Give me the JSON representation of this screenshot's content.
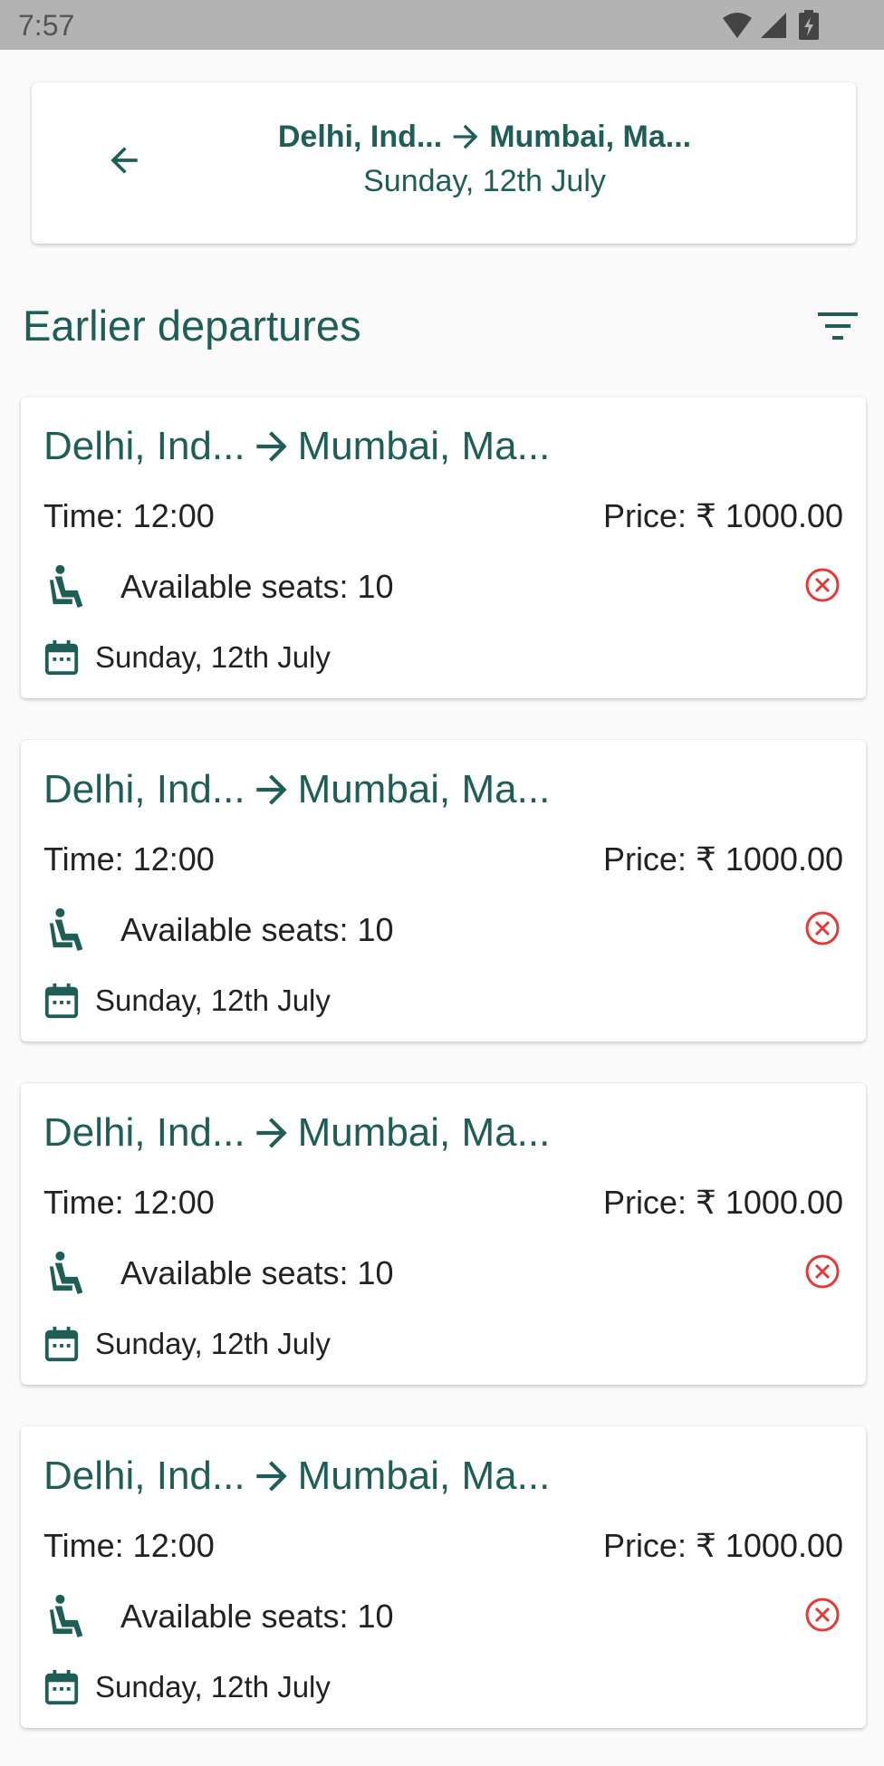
{
  "status_bar": {
    "time": "7:57"
  },
  "header": {
    "from": "Delhi, Ind...",
    "to": "Mumbai, Ma...",
    "date": "Sunday, 12th July"
  },
  "section": {
    "title": "Earlier departures"
  },
  "trips": [
    {
      "from": "Delhi, Ind...",
      "to": "Mumbai, Ma...",
      "time": "Time: 12:00",
      "price": "Price: ₹ 1000.00",
      "seats": "Available seats: 10",
      "date": "Sunday, 12th July"
    },
    {
      "from": "Delhi, Ind...",
      "to": "Mumbai, Ma...",
      "time": "Time: 12:00",
      "price": "Price: ₹ 1000.00",
      "seats": "Available seats: 10",
      "date": "Sunday, 12th July"
    },
    {
      "from": "Delhi, Ind...",
      "to": "Mumbai, Ma...",
      "time": "Time: 12:00",
      "price": "Price: ₹ 1000.00",
      "seats": "Available seats: 10",
      "date": "Sunday, 12th July"
    },
    {
      "from": "Delhi, Ind...",
      "to": "Mumbai, Ma...",
      "time": "Time: 12:00",
      "price": "Price: ₹ 1000.00",
      "seats": "Available seats: 10",
      "date": "Sunday, 12th July"
    }
  ],
  "icons": {
    "back": "arrow-back-icon",
    "filter": "filter-icon",
    "seat": "seat-icon",
    "cancel": "cancel-circle-icon",
    "calendar": "calendar-icon",
    "route_arrow": "arrow-right-icon"
  },
  "colors": {
    "primary": "#1f5d57",
    "cancel": "#e53935",
    "status_bar": "#b3b3b3",
    "background": "#fafafa"
  }
}
